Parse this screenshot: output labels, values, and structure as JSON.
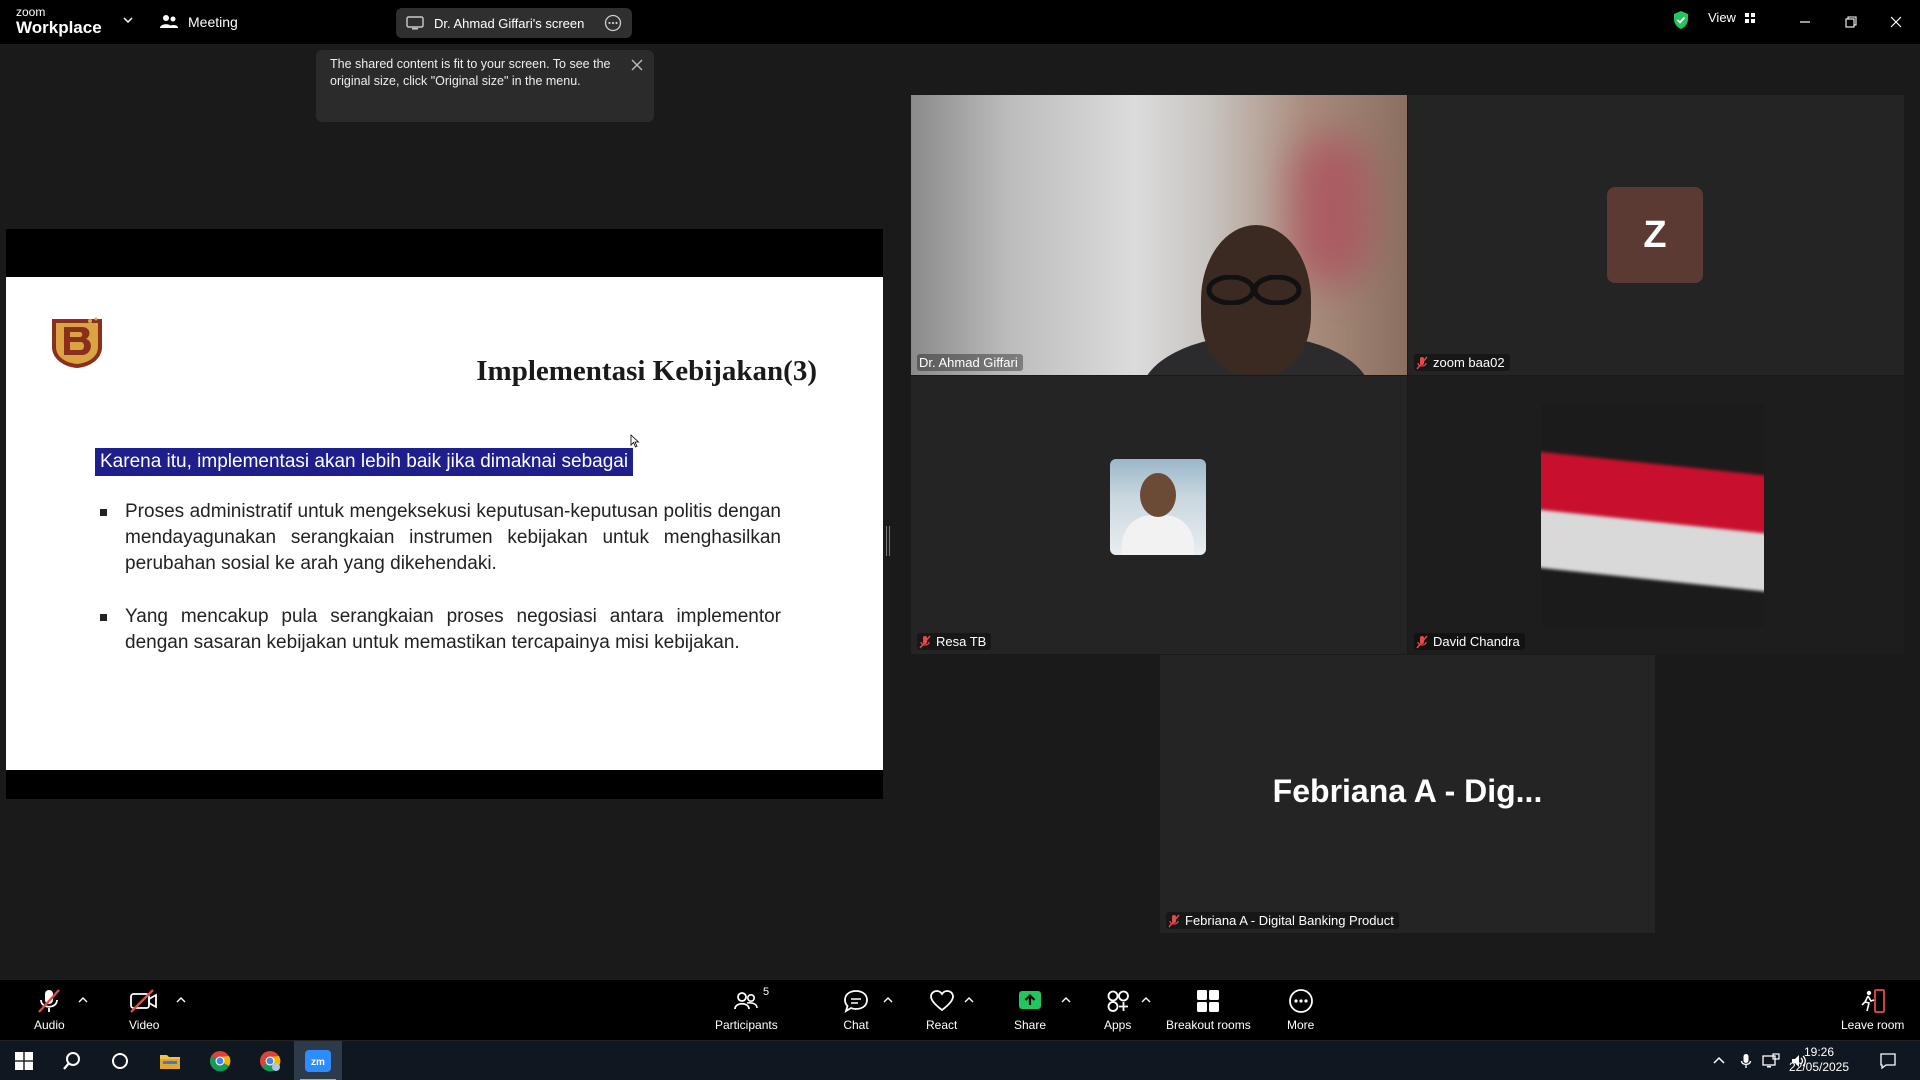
{
  "topbar": {
    "brand_line1": "zoom",
    "brand_line2": "Workplace",
    "meeting_label": "Meeting",
    "share_pill_label": "Dr. Ahmad Giffari's screen",
    "view_label": "View"
  },
  "tooltip": {
    "text": "The shared content is fit to your screen. To see the original size, click \"Original size\" in the menu."
  },
  "slide": {
    "title": "Implementasi Kebijakan(3)",
    "highlighted": "Karena itu, implementasi akan lebih baik jika dimaknai sebagai",
    "bullets": [
      "Proses administratif untuk mengeksekusi keputusan-keputusan politis dengan mendayagunakan serangkaian instrumen kebijakan untuk menghasilkan perubahan sosial ke arah yang dikehendaki.",
      "Yang mencakup pula serangkaian proses negosiasi antara implementor dengan sasaran kebijakan untuk memastikan tercapainya misi kebijakan."
    ]
  },
  "participants_tiles": [
    {
      "name": "Dr. Ahmad Giffari",
      "muted": false,
      "active_speaker": true
    },
    {
      "name": "zoom baa02",
      "muted": true,
      "avatar_letter": "Z"
    },
    {
      "name": "Resa TB",
      "muted": true
    },
    {
      "name": "David Chandra",
      "muted": true
    },
    {
      "name": "Febriana A - Digital Banking Product",
      "muted": true,
      "display_name": "Febriana A - Dig..."
    }
  ],
  "toolbar": {
    "audio": "Audio",
    "video": "Video",
    "participants": "Participants",
    "participants_count": "5",
    "chat": "Chat",
    "react": "React",
    "share": "Share",
    "apps": "Apps",
    "breakout": "Breakout rooms",
    "more": "More",
    "leave": "Leave room"
  },
  "taskbar": {
    "time": "19:26",
    "date": "22/05/2025"
  },
  "colors": {
    "active_speaker": "#22c55e",
    "share_green": "#22c55e",
    "muted_red": "#e5484d",
    "highlight": "#1e1e8c"
  }
}
